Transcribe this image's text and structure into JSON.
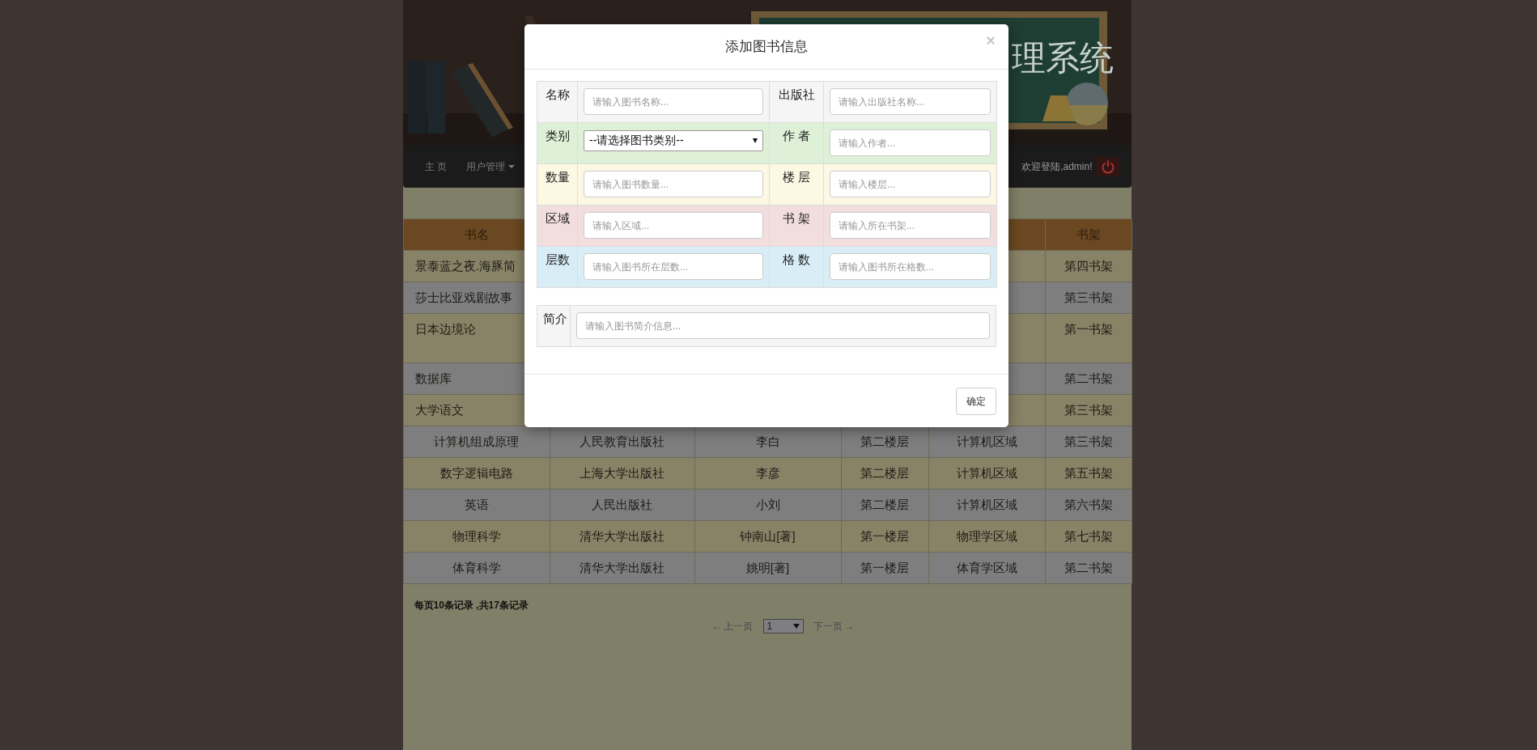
{
  "header": {
    "banner_title": "理系统"
  },
  "nav": {
    "items": [
      {
        "label": "主 页",
        "dropdown": false
      },
      {
        "label": "用户管理",
        "dropdown": true
      }
    ],
    "welcome": "欢迎登陆,admin!"
  },
  "table": {
    "columns": [
      "书名",
      null,
      null,
      null,
      null,
      "书架"
    ],
    "rows": [
      {
        "tall": false,
        "cells": [
          "景泰蓝之夜.海豚简",
          null,
          null,
          null,
          null,
          "第四书架"
        ]
      },
      {
        "tall": false,
        "cells": [
          "莎士比亚戏剧故事",
          null,
          null,
          null,
          null,
          "第三书架"
        ]
      },
      {
        "tall": true,
        "cells": [
          "日本边境论",
          null,
          null,
          null,
          null,
          "第一书架"
        ]
      },
      {
        "tall": false,
        "cells": [
          "数据库",
          null,
          null,
          null,
          null,
          "第二书架"
        ]
      },
      {
        "tall": false,
        "cells": [
          "大学语文",
          null,
          null,
          null,
          null,
          "第三书架"
        ]
      },
      {
        "tall": false,
        "cells": [
          "计算机组成原理",
          "人民教育出版社",
          "李白",
          "第二楼层",
          "计算机区域",
          "第三书架"
        ]
      },
      {
        "tall": false,
        "cells": [
          "数字逻辑电路",
          "上海大学出版社",
          "李彦",
          "第二楼层",
          "计算机区域",
          "第五书架"
        ]
      },
      {
        "tall": false,
        "cells": [
          "英语",
          "人民出版社",
          "小刘",
          "第二楼层",
          "计算机区域",
          "第六书架"
        ]
      },
      {
        "tall": false,
        "cells": [
          "物理科学",
          "清华大学出版社",
          "钟南山[著]",
          "第一楼层",
          "物理学区域",
          "第七书架"
        ]
      },
      {
        "tall": false,
        "cells": [
          "体育科学",
          "清华大学出版社",
          "姚明[著]",
          "第一楼层",
          "体育学区域",
          "第二书架"
        ]
      }
    ]
  },
  "pager": {
    "summary": "每页10条记录 ,共17条记录",
    "prev": "← 上一页",
    "page": "1",
    "next": "下一页 →"
  },
  "modal": {
    "title": "添加图书信息",
    "close": "×",
    "rows": [
      {
        "color": "#f5f5f5",
        "fields": [
          {
            "label": "名称",
            "kind": "input",
            "placeholder": "请输入图书名称..."
          },
          {
            "label": "出版社",
            "kind": "input",
            "placeholder": "请输入出版社名称..."
          }
        ]
      },
      {
        "color": "#dff0d8",
        "fields": [
          {
            "label": "类别",
            "kind": "select",
            "value": "--请选择图书类别--"
          },
          {
            "label": "作 者",
            "kind": "input",
            "placeholder": "请输入作者..."
          }
        ]
      },
      {
        "color": "#fcf8e3",
        "fields": [
          {
            "label": "数量",
            "kind": "input",
            "placeholder": "请输入图书数量..."
          },
          {
            "label": "楼 层",
            "kind": "input",
            "placeholder": "请输入楼层..."
          }
        ]
      },
      {
        "color": "#f2dede",
        "fields": [
          {
            "label": "区域",
            "kind": "input",
            "placeholder": "请输入区域..."
          },
          {
            "label": "书 架",
            "kind": "input",
            "placeholder": "请输入所在书架..."
          }
        ]
      },
      {
        "color": "#d9edf7",
        "fields": [
          {
            "label": "层数",
            "kind": "input",
            "placeholder": "请输入图书所在层数..."
          },
          {
            "label": "格 数",
            "kind": "input",
            "placeholder": "请输入图书所在格数..."
          }
        ]
      }
    ],
    "intro": {
      "label": "简介",
      "placeholder": "请输入图书简介信息..."
    },
    "confirm": "确定"
  }
}
